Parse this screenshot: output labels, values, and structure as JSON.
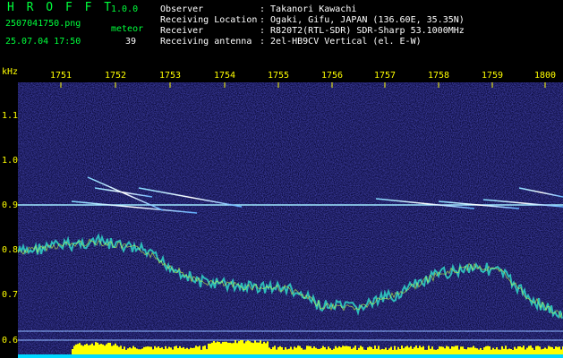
{
  "header": {
    "app_title": "H R O F F T",
    "app_version": "1.0.0",
    "file_name": "2507041750.png",
    "datetime": "25.07.04 17:50",
    "detector_label": "meteor",
    "detector_count": "39",
    "info": [
      {
        "key": "Observer",
        "value": ": Takanori Kawachi"
      },
      {
        "key": "Receiving Location",
        "value": ": Ogaki, Gifu, JAPAN (136.60E, 35.35N)"
      },
      {
        "key": "Receiver",
        "value": ": R820T2(RTL-SDR) SDR-Sharp 53.1000MHz"
      },
      {
        "key": "Receiving antenna",
        "value": ": 2el-HB9CV Vertical (el. E-W)"
      }
    ]
  },
  "axes": {
    "y_unit": "kHz",
    "y_ticks": [
      "1.1",
      "1.0",
      "0.9",
      "0.8",
      "0.7",
      "0.6"
    ],
    "x_ticks": [
      "1751",
      "1752",
      "1753",
      "1754",
      "1755",
      "1756",
      "1757",
      "1758",
      "1759",
      "1800"
    ]
  },
  "colors": {
    "background": "#000000",
    "noise": "#1a1a8c",
    "header_text": "#00ff3c",
    "tick_text": "#ffff00",
    "info_text": "#ffffff",
    "baseline": "#00ffff",
    "level_bar": "#ffff00"
  }
}
